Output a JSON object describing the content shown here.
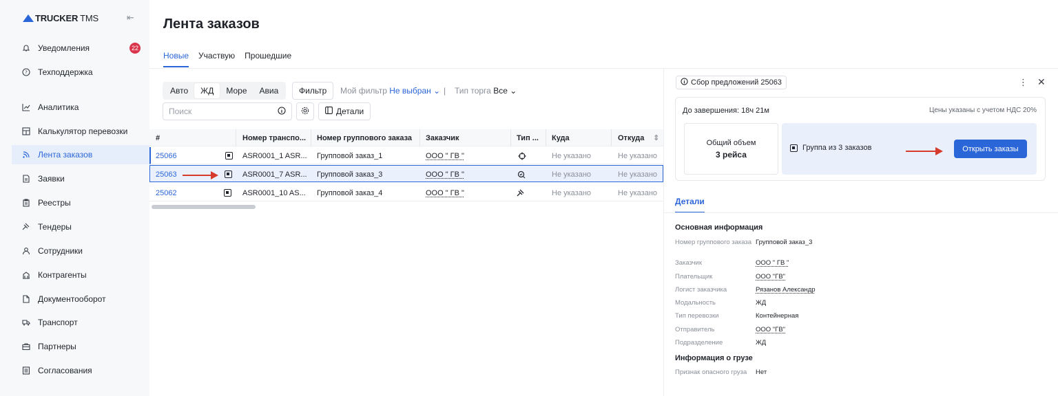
{
  "app": {
    "brand_bold": "TRUCKER",
    "brand_light": "TMS"
  },
  "sidebar": {
    "top_items": [
      {
        "label": "Уведомления",
        "badge": "22"
      },
      {
        "label": "Техподдержка"
      }
    ],
    "items": [
      {
        "label": "Аналитика"
      },
      {
        "label": "Калькулятор перевозки"
      },
      {
        "label": "Лента заказов"
      },
      {
        "label": "Заявки"
      },
      {
        "label": "Реестры"
      },
      {
        "label": "Тендеры"
      },
      {
        "label": "Сотрудники"
      },
      {
        "label": "Контрагенты"
      },
      {
        "label": "Документооборот"
      },
      {
        "label": "Транспорт"
      },
      {
        "label": "Партнеры"
      },
      {
        "label": "Согласования"
      }
    ],
    "active_index": 2,
    "accent": "#2b66d9"
  },
  "main": {
    "title": "Лента заказов",
    "tabs": [
      {
        "label": "Новые"
      },
      {
        "label": "Участвую"
      },
      {
        "label": "Прошедшие"
      }
    ],
    "modes": [
      {
        "label": "Авто"
      },
      {
        "label": "ЖД"
      },
      {
        "label": "Море"
      },
      {
        "label": "Авиа"
      }
    ],
    "filter_button": "Фильтр",
    "my_filter_label": "Мой фильтр",
    "my_filter_value": "Не выбран",
    "trade_type_label": "Тип торга",
    "trade_type_value": "Все",
    "search_placeholder": "Поиск",
    "details_button": "Детали"
  },
  "table": {
    "headers": [
      "#",
      "Номер транспо...",
      "Номер группового заказа",
      "Заказчик",
      "Тип ...",
      "Куда",
      "Откуда"
    ],
    "rows": [
      {
        "id": "25066",
        "transport": "ASR0001_1 ASR...",
        "group": "Групповой заказ_1",
        "customer": "ООО \" ГВ \"",
        "type_icon": "crosshair-icon",
        "to": "Не указано",
        "from": "Не указано"
      },
      {
        "id": "25063",
        "transport": "ASR0001_7 ASR...",
        "group": "Групповой заказ_3",
        "customer": "ООО \" ГВ \"",
        "type_icon": "search-check-icon",
        "to": "Не указано",
        "from": "Не указано"
      },
      {
        "id": "25062",
        "transport": "ASR0001_10 AS...",
        "group": "Групповой заказ_4",
        "customer": "ООО \" ГВ \"",
        "type_icon": "gavel-icon",
        "to": "Не указано",
        "from": "Не указано"
      }
    ]
  },
  "panel": {
    "chip": "Сбор предложений 25063",
    "until_end": "До завершения: 18ч 21м",
    "vat_note": "Цены указаны с учетом НДС 20%",
    "total_volume_label": "Общий объем",
    "total_volume_value": "3 рейса",
    "group_label": "Группа из 3 заказов",
    "open_button": "Открыть заказы",
    "details_tab": "Детали",
    "basic_title": "Основная информация",
    "fields": [
      {
        "k": "Номер группового заказа",
        "v": "Групповой заказ_3"
      },
      {
        "k": "Заказчик",
        "v": "ООО \" ГВ \""
      },
      {
        "k": "Плательщик",
        "v": "ООО \"ГВ\""
      },
      {
        "k": "Логист заказчика",
        "v": "Рязанов Александр"
      },
      {
        "k": "Модальность",
        "v": "ЖД"
      },
      {
        "k": "Тип перевозки",
        "v": "Контейнерная"
      },
      {
        "k": "Отправитель",
        "v": "ООО \"ГВ\""
      },
      {
        "k": "Подразделение",
        "v": "ЖД"
      }
    ],
    "cargo_title": "Информация о грузе",
    "cargo_fields": [
      {
        "k": "Признак опасного груза",
        "v": "Нет"
      }
    ]
  }
}
